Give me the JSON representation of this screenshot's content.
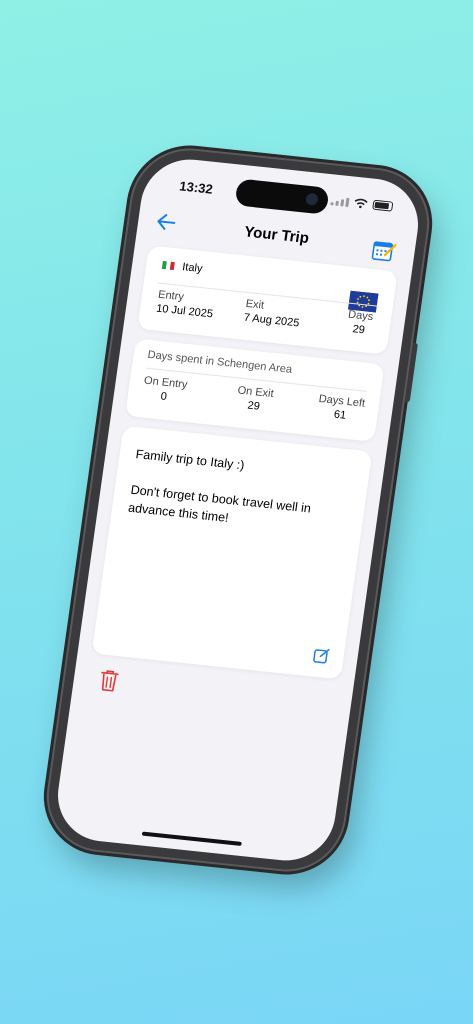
{
  "status": {
    "time": "13:32"
  },
  "nav": {
    "title": "Your Trip",
    "back_icon": "arrow-left-icon",
    "calendar_icon": "calendar-edit-icon"
  },
  "trip": {
    "country": "Italy",
    "flag_icon": "flag-italy-icon",
    "region_icon": "flag-eu-icon",
    "entry_label": "Entry",
    "entry_value": "10 Jul 2025",
    "exit_label": "Exit",
    "exit_value": "7 Aug 2025",
    "days_label": "Days",
    "days_value": "29"
  },
  "schengen": {
    "title": "Days spent in Schengen Area",
    "on_entry_label": "On Entry",
    "on_entry_value": "0",
    "on_exit_label": "On Exit",
    "on_exit_value": "29",
    "days_left_label": "Days Left",
    "days_left_value": "61"
  },
  "notes": {
    "text": "Family trip to Italy :)\n\nDon't forget to book travel well in advance this time!",
    "edit_icon": "edit-icon"
  },
  "actions": {
    "delete_icon": "trash-icon"
  },
  "colors": {
    "accent": "#1a7ee8",
    "destructive": "#e53935",
    "background": "#f2f2f7"
  }
}
